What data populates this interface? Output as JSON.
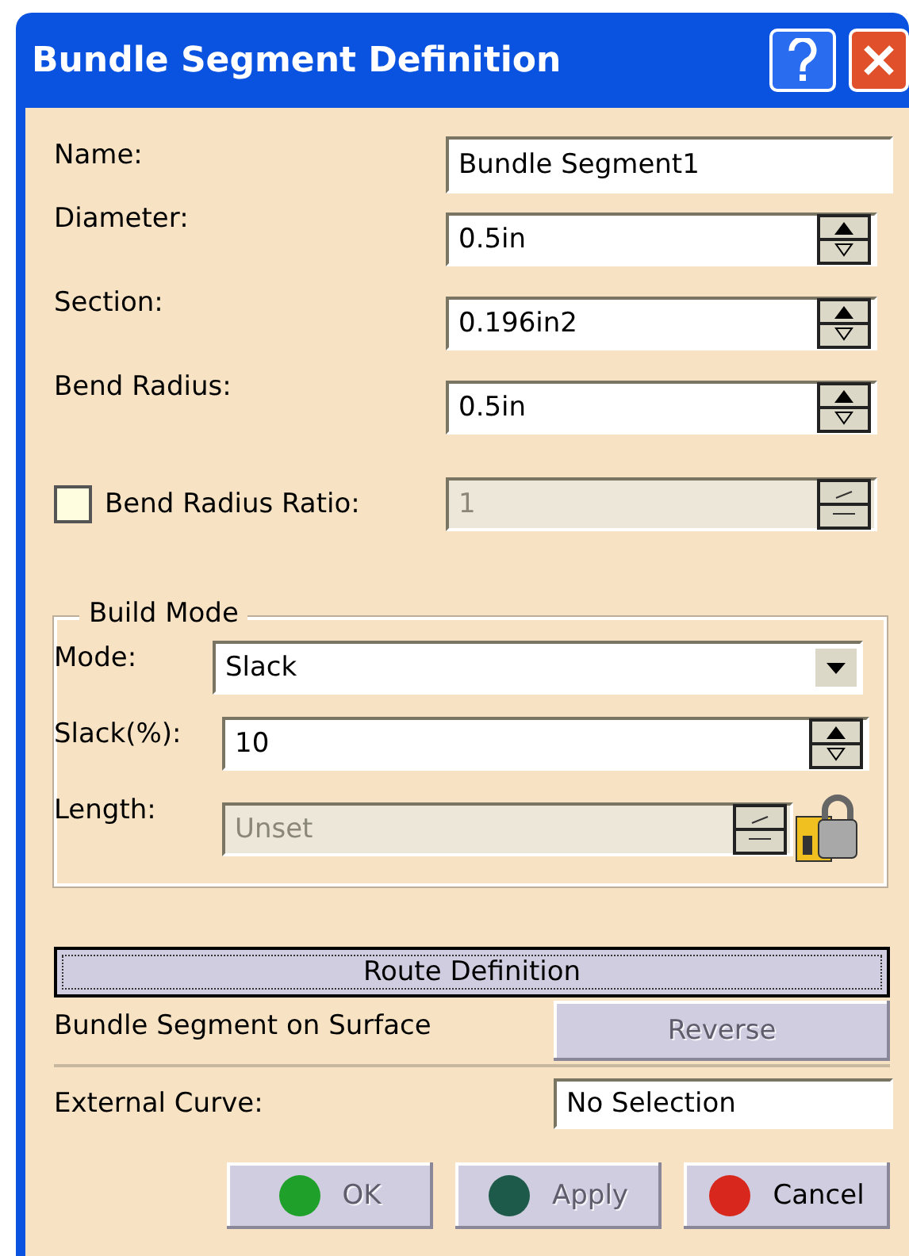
{
  "window": {
    "title": "Bundle Segment Definition"
  },
  "fields": [
    {
      "kind": "text",
      "label": "Name:",
      "value": "Bundle Segment1"
    },
    {
      "kind": "spin",
      "label": "Diameter:",
      "value": "0.5in"
    },
    {
      "kind": "spin",
      "label": "Section:",
      "value": "0.196in2"
    },
    {
      "kind": "spin",
      "label": "Bend Radius:",
      "value": "0.5in"
    },
    {
      "kind": "check",
      "label": "Bend Radius Ratio:",
      "checked": false,
      "value": "1",
      "disabled": true
    }
  ],
  "build_mode": {
    "title": "Build Mode",
    "rows": [
      {
        "kind": "combo",
        "label": "Mode:",
        "value": "Slack"
      },
      {
        "kind": "spin",
        "label": "Slack(%):",
        "value": "10"
      },
      {
        "kind": "locked",
        "label": "Length:",
        "value": "Unset",
        "disabled": true
      }
    ]
  },
  "route_button": "Route Definition",
  "surface": {
    "label": "Bundle Segment on Surface",
    "button": "Reverse",
    "disabled": true
  },
  "external_curve": {
    "label": "External Curve:",
    "value": "No Selection"
  },
  "buttons": [
    {
      "label": "OK",
      "disabled": true,
      "color": "#1fa02a"
    },
    {
      "label": "Apply",
      "disabled": true,
      "color": "#1e5a4a"
    },
    {
      "label": "Cancel",
      "disabled": false,
      "color": "#d8281e"
    }
  ]
}
